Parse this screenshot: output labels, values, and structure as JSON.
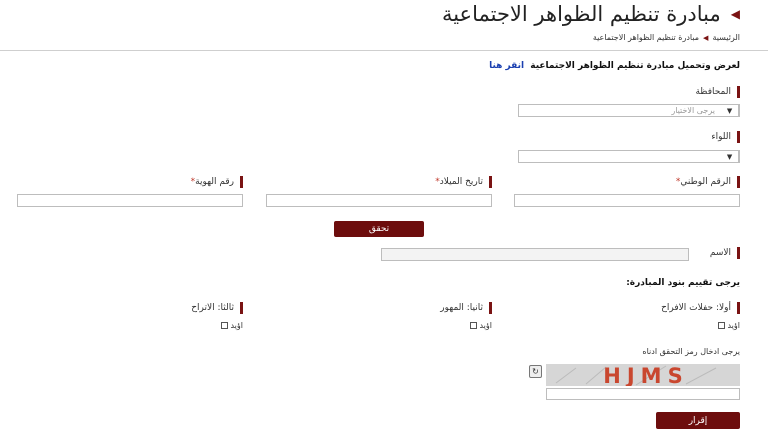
{
  "header": {
    "title": "مبادرة تنظيم الظواهر الاجتماعية",
    "breadcrumb": {
      "home": "الرئيسية",
      "current": "مبادرة تنظيم الظواهر الاجتماعية"
    }
  },
  "intro": {
    "text": "لعرض وتحميل مبادرة تنظيم الظواهر الاجتماعية",
    "link": "انقر هنا"
  },
  "form": {
    "governorate": {
      "label": "المحافظة",
      "placeholder": "يرجى الاختيار"
    },
    "brigade": {
      "label": "اللواء",
      "placeholder": ""
    },
    "national_id": {
      "label": "الرقم الوطني",
      "required_mark": "*"
    },
    "birth_date": {
      "label": "تاريخ الميلاد",
      "required_mark": "*"
    },
    "id_number": {
      "label": "رقم الهوية",
      "required_mark": "*"
    },
    "verify_button": "تحقق",
    "name": {
      "label": "الاسم"
    }
  },
  "evaluation": {
    "heading": "يرجى تقييم بنود المبادرة:",
    "items": [
      {
        "label": "أولا: حفلات الافراح",
        "option": "اؤيد"
      },
      {
        "label": "ثانيا: المهور",
        "option": "اؤيد"
      },
      {
        "label": "ثالثا: الاتراح",
        "option": "اؤيد"
      }
    ]
  },
  "captcha": {
    "prompt": "يرجى ادخال رمز التحقق ادناه",
    "code": "HJMS"
  },
  "submit_button": "إقرار",
  "colors": {
    "accent": "#6d0d0d",
    "link": "#1a3fb0",
    "required": "#c0392b"
  }
}
